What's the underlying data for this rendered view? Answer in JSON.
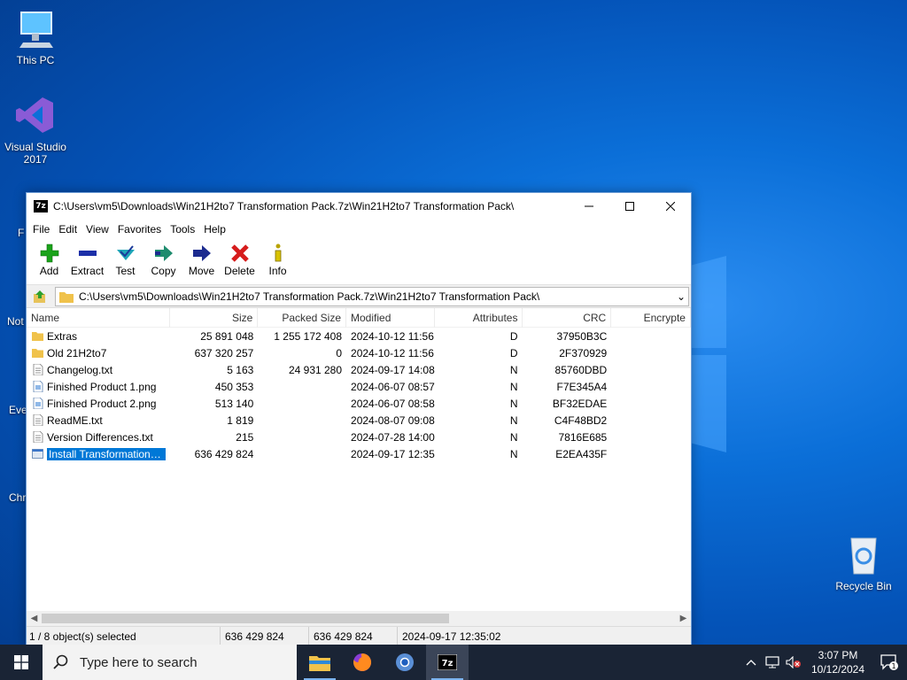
{
  "desktop": {
    "icons": [
      {
        "label": "This PC"
      },
      {
        "label": "Visual Studio 2017"
      },
      {
        "label": "Recycle Bin"
      }
    ],
    "partial_labels": [
      "F",
      "Not",
      "Eve",
      "Chr"
    ]
  },
  "window": {
    "title": "C:\\Users\\vm5\\Downloads\\Win21H2to7 Transformation Pack.7z\\Win21H2to7 Transformation Pack\\",
    "app_icon_text": "7z",
    "menu": [
      "File",
      "Edit",
      "View",
      "Favorites",
      "Tools",
      "Help"
    ],
    "toolbar": [
      {
        "label": "Add",
        "icon": "plus-icon",
        "color": "#1aa31a"
      },
      {
        "label": "Extract",
        "icon": "minus-icon",
        "color": "#1c2fa8"
      },
      {
        "label": "Test",
        "icon": "check-icon",
        "color": "#1fa6b8"
      },
      {
        "label": "Copy",
        "icon": "double-arrow-icon",
        "color": "#1e8c6e"
      },
      {
        "label": "Move",
        "icon": "arrow-icon",
        "color": "#1c2b8f"
      },
      {
        "label": "Delete",
        "icon": "x-icon",
        "color": "#d61c1c"
      },
      {
        "label": "Info",
        "icon": "info-icon",
        "color": "#b8a200"
      }
    ],
    "address": "C:\\Users\\vm5\\Downloads\\Win21H2to7 Transformation Pack.7z\\Win21H2to7 Transformation Pack\\",
    "columns": [
      "Name",
      "Size",
      "Packed Size",
      "Modified",
      "Attributes",
      "CRC",
      "Encrypte"
    ],
    "files": [
      {
        "name": "Extras",
        "type": "folder",
        "size": "25 891 048",
        "packed": "1 255 172 408",
        "modified": "2024-10-12 11:56",
        "attr": "D",
        "crc": "37950B3C"
      },
      {
        "name": "Old 21H2to7",
        "type": "folder",
        "size": "637 320 257",
        "packed": "0",
        "modified": "2024-10-12 11:56",
        "attr": "D",
        "crc": "2F370929"
      },
      {
        "name": "Changelog.txt",
        "type": "text",
        "size": "5 163",
        "packed": "24 931 280",
        "modified": "2024-09-17 14:08",
        "attr": "N",
        "crc": "85760DBD"
      },
      {
        "name": "Finished Product 1.png",
        "type": "image",
        "size": "450 353",
        "packed": "",
        "modified": "2024-06-07 08:57",
        "attr": "N",
        "crc": "F7E345A4"
      },
      {
        "name": "Finished Product 2.png",
        "type": "image",
        "size": "513 140",
        "packed": "",
        "modified": "2024-06-07 08:58",
        "attr": "N",
        "crc": "BF32EDAE"
      },
      {
        "name": "ReadME.txt",
        "type": "text",
        "size": "1 819",
        "packed": "",
        "modified": "2024-08-07 09:08",
        "attr": "N",
        "crc": "C4F48BD2"
      },
      {
        "name": "Version Differences.txt",
        "type": "text",
        "size": "215",
        "packed": "",
        "modified": "2024-07-28 14:00",
        "attr": "N",
        "crc": "7816E685"
      },
      {
        "name": "Install Transformation P...",
        "type": "exe",
        "size": "636 429 824",
        "packed": "",
        "modified": "2024-09-17 12:35",
        "attr": "N",
        "crc": "E2EA435F",
        "selected": true
      }
    ],
    "status": [
      "1 / 8 object(s) selected",
      "636 429 824",
      "636 429 824",
      "2024-09-17 12:35:02"
    ]
  },
  "taskbar": {
    "search_placeholder": "Type here to search",
    "apps": [
      "file-explorer-icon",
      "firefox-icon",
      "chrome-icon",
      "7zip-icon"
    ],
    "time": "3:07 PM",
    "date": "10/12/2024",
    "notification_count": "1"
  }
}
